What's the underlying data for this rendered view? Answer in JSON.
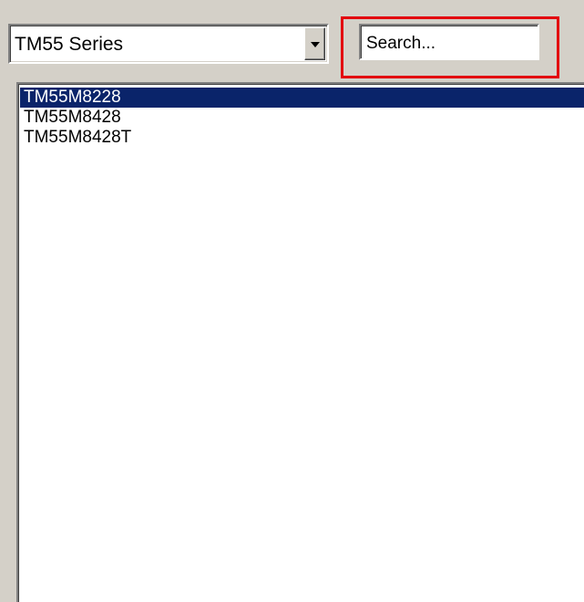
{
  "series_dropdown": {
    "selected": "TM55 Series"
  },
  "search": {
    "placeholder": "Search..."
  },
  "model_list": {
    "items": [
      "TM55M8228",
      "TM55M8428",
      "TM55M8428T"
    ],
    "selected_item": "TM55M8228"
  },
  "colors": {
    "window_bg": "#d4d0c8",
    "selection_bg": "#0a246a",
    "highlight_border": "#e3000f"
  }
}
